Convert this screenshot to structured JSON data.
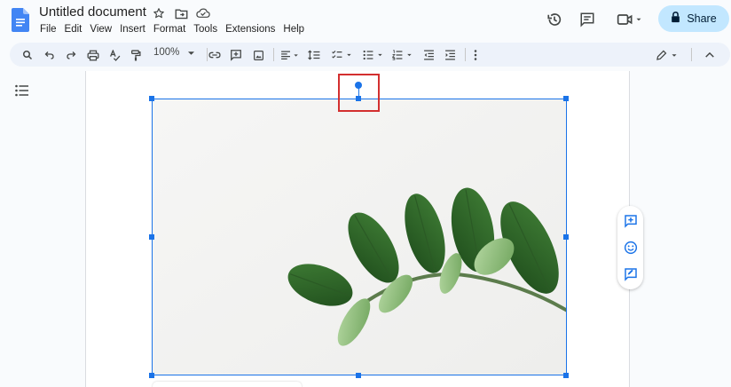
{
  "document": {
    "title": "Untitled document"
  },
  "menu": {
    "items": [
      "File",
      "Edit",
      "View",
      "Insert",
      "Format",
      "Tools",
      "Extensions",
      "Help"
    ]
  },
  "header": {
    "share_label": "Share"
  },
  "toolbar": {
    "zoom_value": "100%"
  },
  "colors": {
    "accent": "#1a73e8",
    "share_bg": "#c2e7ff",
    "highlight": "#d32f2f"
  },
  "icons": {
    "header": [
      "star-icon",
      "move-folder-icon",
      "cloud-saved-icon",
      "history-icon",
      "comments-icon",
      "meet-icon",
      "lock-icon"
    ],
    "toolbar": [
      "search-icon",
      "undo-icon",
      "redo-icon",
      "print-icon",
      "spellcheck-icon",
      "paint-format-icon",
      "link-icon",
      "add-comment-icon",
      "insert-image-icon",
      "align-icon",
      "line-spacing-icon",
      "checklist-icon",
      "bulleted-list-icon",
      "numbered-list-icon",
      "decrease-indent-icon",
      "increase-indent-icon",
      "more-options-icon",
      "editing-mode-icon",
      "collapse-menus-icon"
    ],
    "side": [
      "add-comment-icon",
      "emoji-reaction-icon",
      "suggest-edits-icon"
    ]
  }
}
